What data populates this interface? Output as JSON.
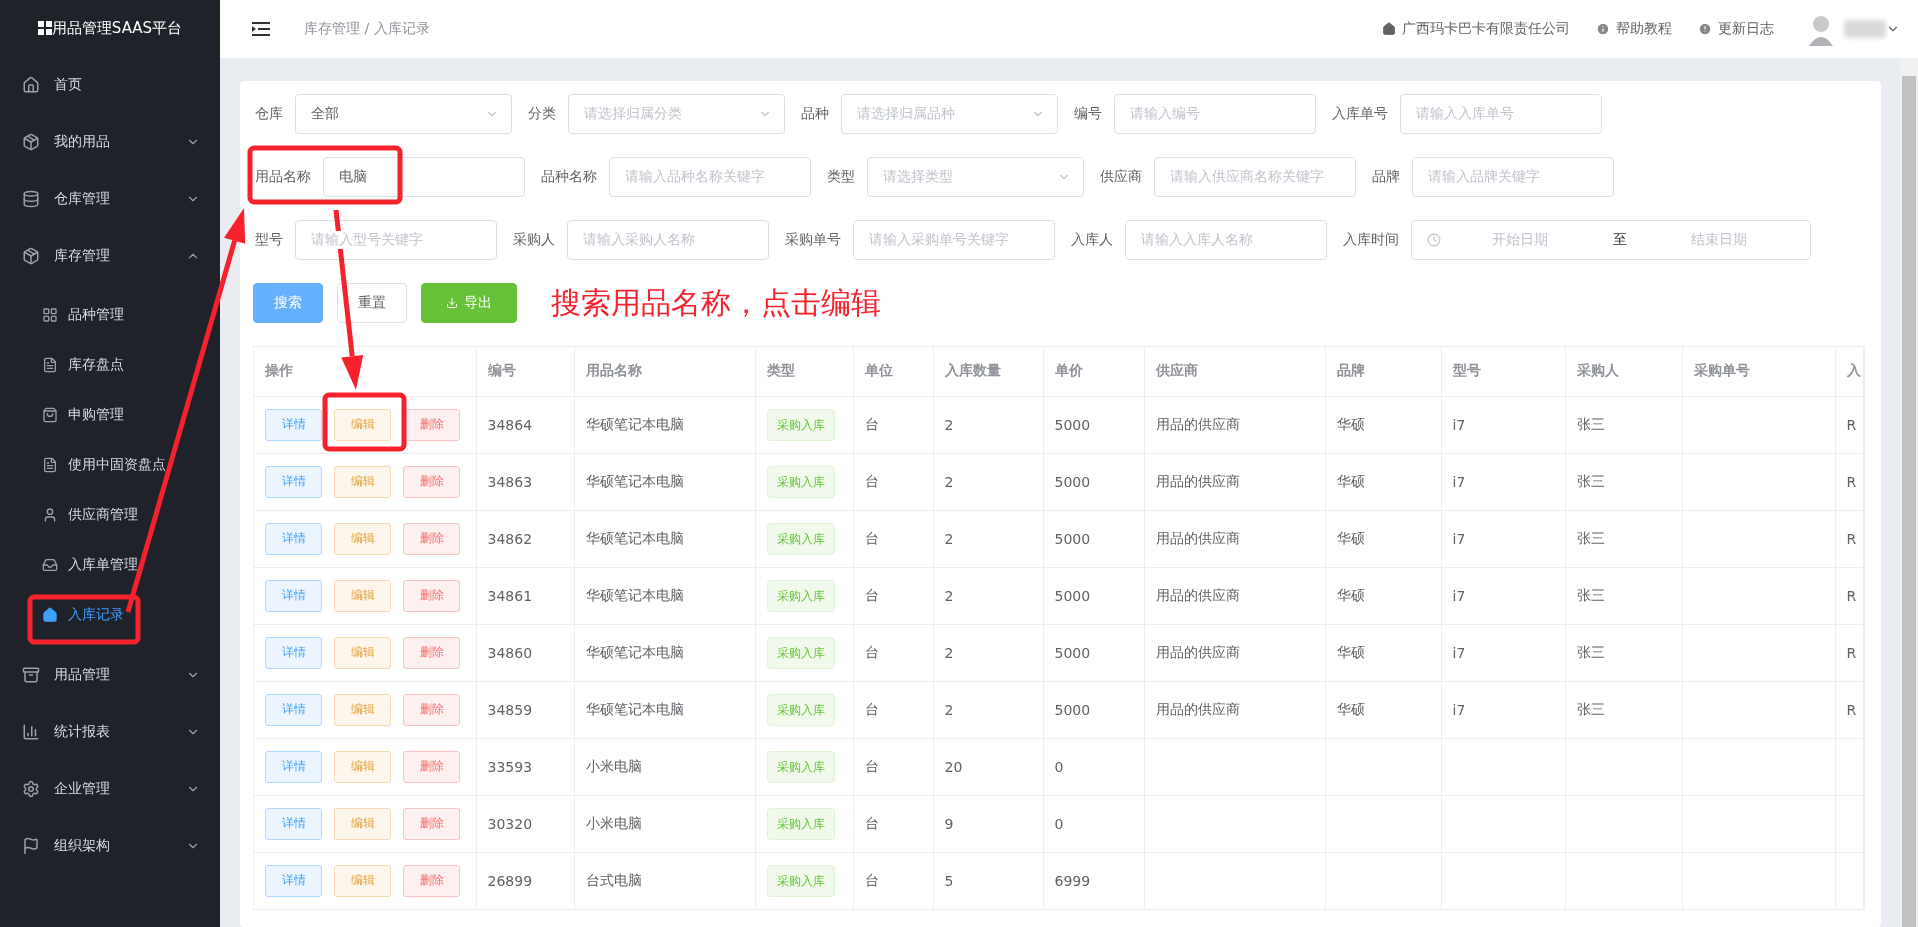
{
  "sidebar": {
    "logo": "用品管理SAAS平台",
    "items": [
      {
        "label": "首页",
        "kind": "link"
      },
      {
        "label": "我的用品",
        "kind": "group",
        "expanded": false
      },
      {
        "label": "仓库管理",
        "kind": "group",
        "expanded": false
      },
      {
        "label": "库存管理",
        "kind": "group",
        "expanded": true,
        "children": [
          {
            "label": "品种管理",
            "selected": false
          },
          {
            "label": "库存盘点",
            "selected": false
          },
          {
            "label": "申购管理",
            "selected": false
          },
          {
            "label": "使用中固资盘点",
            "selected": false
          },
          {
            "label": "供应商管理",
            "selected": false
          },
          {
            "label": "入库单管理",
            "selected": false
          },
          {
            "label": "入库记录",
            "selected": true
          }
        ]
      },
      {
        "label": "用品管理",
        "kind": "group",
        "expanded": false
      },
      {
        "label": "统计报表",
        "kind": "group",
        "expanded": false
      },
      {
        "label": "企业管理",
        "kind": "group",
        "expanded": false
      },
      {
        "label": "组织架构",
        "kind": "group",
        "expanded": false
      }
    ]
  },
  "header": {
    "breadcrumb": "库存管理 / 入库记录",
    "company": "广西玛卡巴卡有限责任公司",
    "links": [
      "帮助教程",
      "更新日志"
    ]
  },
  "filters": [
    [
      {
        "label": "仓库",
        "kind": "select",
        "value": "全部"
      },
      {
        "label": "分类",
        "kind": "select",
        "placeholder": "请选择归属分类"
      },
      {
        "label": "品种",
        "kind": "select",
        "placeholder": "请选择归属品种"
      },
      {
        "label": "编号",
        "kind": "input",
        "placeholder": "请输入编号"
      },
      {
        "label": "入库单号",
        "kind": "input",
        "placeholder": "请输入入库单号"
      }
    ],
    [
      {
        "label": "用品名称",
        "kind": "input",
        "value": "电脑"
      },
      {
        "label": "品种名称",
        "kind": "input",
        "placeholder": "请输入品种名称关键字"
      },
      {
        "label": "类型",
        "kind": "select",
        "placeholder": "请选择类型"
      },
      {
        "label": "供应商",
        "kind": "input",
        "placeholder": "请输入供应商名称关键字"
      },
      {
        "label": "品牌",
        "kind": "input",
        "placeholder": "请输入品牌关键字"
      }
    ],
    [
      {
        "label": "型号",
        "kind": "input",
        "placeholder": "请输入型号关键字"
      },
      {
        "label": "采购人",
        "kind": "input",
        "placeholder": "请输入采购人名称"
      },
      {
        "label": "采购单号",
        "kind": "input",
        "placeholder": "请输入采购单号关键字"
      },
      {
        "label": "入库人",
        "kind": "input",
        "placeholder": "请输入入库人名称"
      },
      {
        "label": "入库时间",
        "kind": "daterange",
        "start_placeholder": "开始日期",
        "separator": "至",
        "end_placeholder": "结束日期"
      }
    ]
  ],
  "buttons": [
    {
      "label": "搜索",
      "kind": "primary"
    },
    {
      "label": "重置",
      "kind": "plain"
    },
    {
      "label": "导出",
      "kind": "success"
    }
  ],
  "annotation": "搜索用品名称，点击编辑",
  "table": {
    "columns": [
      "操作",
      "编号",
      "用品名称",
      "类型",
      "单位",
      "入库数量",
      "单价",
      "供应商",
      "品牌",
      "型号",
      "采购人",
      "采购单号",
      "入"
    ],
    "rows": [
      {
        "cells": [
          [
            {
              "label": "详情",
              "kind": "detail"
            },
            {
              "label": "编辑",
              "kind": "edit"
            },
            {
              "label": "删除",
              "kind": "delete"
            }
          ],
          "34864",
          "华硕笔记本电脑",
          "采购入库",
          "台",
          "2",
          "5000",
          "用品的供应商",
          "华硕",
          "i7",
          "张三",
          "",
          "R"
        ]
      },
      {
        "cells": [
          [
            {
              "label": "详情",
              "kind": "detail"
            },
            {
              "label": "编辑",
              "kind": "edit"
            },
            {
              "label": "删除",
              "kind": "delete"
            }
          ],
          "34863",
          "华硕笔记本电脑",
          "采购入库",
          "台",
          "2",
          "5000",
          "用品的供应商",
          "华硕",
          "i7",
          "张三",
          "",
          "R"
        ]
      },
      {
        "cells": [
          [
            {
              "label": "详情",
              "kind": "detail"
            },
            {
              "label": "编辑",
              "kind": "edit"
            },
            {
              "label": "删除",
              "kind": "delete"
            }
          ],
          "34862",
          "华硕笔记本电脑",
          "采购入库",
          "台",
          "2",
          "5000",
          "用品的供应商",
          "华硕",
          "i7",
          "张三",
          "",
          "R"
        ]
      },
      {
        "cells": [
          [
            {
              "label": "详情",
              "kind": "detail"
            },
            {
              "label": "编辑",
              "kind": "edit"
            },
            {
              "label": "删除",
              "kind": "delete"
            }
          ],
          "34861",
          "华硕笔记本电脑",
          "采购入库",
          "台",
          "2",
          "5000",
          "用品的供应商",
          "华硕",
          "i7",
          "张三",
          "",
          "R"
        ]
      },
      {
        "cells": [
          [
            {
              "label": "详情",
              "kind": "detail"
            },
            {
              "label": "编辑",
              "kind": "edit"
            },
            {
              "label": "删除",
              "kind": "delete"
            }
          ],
          "34860",
          "华硕笔记本电脑",
          "采购入库",
          "台",
          "2",
          "5000",
          "用品的供应商",
          "华硕",
          "i7",
          "张三",
          "",
          "R"
        ]
      },
      {
        "cells": [
          [
            {
              "label": "详情",
              "kind": "detail"
            },
            {
              "label": "编辑",
              "kind": "edit"
            },
            {
              "label": "删除",
              "kind": "delete"
            }
          ],
          "34859",
          "华硕笔记本电脑",
          "采购入库",
          "台",
          "2",
          "5000",
          "用品的供应商",
          "华硕",
          "i7",
          "张三",
          "",
          "R"
        ]
      },
      {
        "cells": [
          [
            {
              "label": "详情",
              "kind": "detail"
            },
            {
              "label": "编辑",
              "kind": "edit"
            },
            {
              "label": "删除",
              "kind": "delete"
            }
          ],
          "33593",
          "小米电脑",
          "采购入库",
          "台",
          "20",
          "0",
          "",
          "",
          "",
          "",
          "",
          ""
        ]
      },
      {
        "cells": [
          [
            {
              "label": "详情",
              "kind": "detail"
            },
            {
              "label": "编辑",
              "kind": "edit"
            },
            {
              "label": "删除",
              "kind": "delete"
            }
          ],
          "30320",
          "小米电脑",
          "采购入库",
          "台",
          "9",
          "0",
          "",
          "",
          "",
          "",
          "",
          ""
        ]
      },
      {
        "cells": [
          [
            {
              "label": "详情",
              "kind": "detail"
            },
            {
              "label": "编辑",
              "kind": "edit"
            },
            {
              "label": "删除",
              "kind": "delete"
            }
          ],
          "26899",
          "台式电脑",
          "采购入库",
          "台",
          "5",
          "6999",
          "",
          "",
          "",
          "",
          "",
          ""
        ]
      }
    ]
  }
}
